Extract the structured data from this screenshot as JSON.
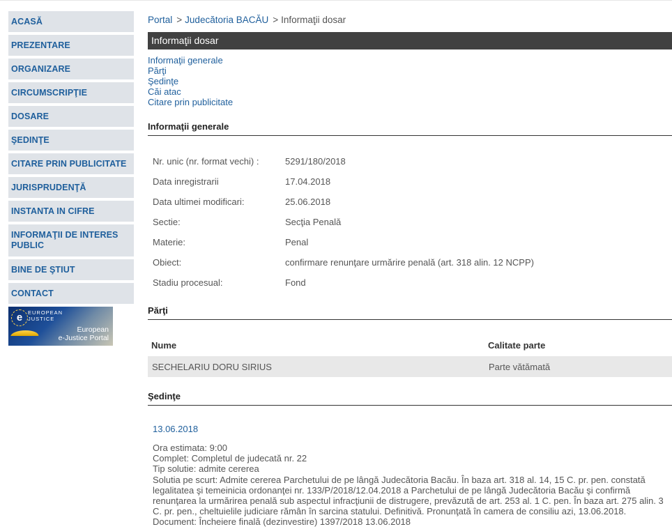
{
  "sidebar": {
    "items": [
      {
        "label": "ACASĂ"
      },
      {
        "label": "PREZENTARE"
      },
      {
        "label": "ORGANIZARE"
      },
      {
        "label": "CIRCUMSCRIPŢIE"
      },
      {
        "label": "DOSARE"
      },
      {
        "label": "ŞEDINŢE"
      },
      {
        "label": "CITARE PRIN PUBLICITATE"
      },
      {
        "label": "JURISPRUDENŢĂ"
      },
      {
        "label": "INSTANTA IN CIFRE"
      },
      {
        "label": "INFORMAŢII DE INTERES PUBLIC"
      },
      {
        "label": "BINE DE ŞTIUT"
      },
      {
        "label": "CONTACT"
      }
    ],
    "ejustice": {
      "logo_letter": "e",
      "line1": "EUROPEAN",
      "line2": "JUSTICE",
      "title1": "European",
      "title2": "e-Justice Portal"
    }
  },
  "breadcrumb": {
    "home": "Portal",
    "sep1": ">",
    "court": "Judecătoria BACĂU",
    "sep2": ">",
    "current": "Informaţii dosar"
  },
  "page_title": "Informaţii dosar",
  "anchors": [
    "Informaţii generale",
    "Părţi",
    "Şedinţe",
    "Căi atac",
    "Citare prin publicitate"
  ],
  "general": {
    "heading": "Informaţii generale",
    "rows": [
      {
        "key": "Nr. unic (nr. format vechi) :",
        "value": "5291/180/2018"
      },
      {
        "key": "Data inregistrarii",
        "value": "17.04.2018"
      },
      {
        "key": "Data ultimei modificari:",
        "value": "25.06.2018"
      },
      {
        "key": "Sectie:",
        "value": "Secţia Penală"
      },
      {
        "key": "Materie:",
        "value": "Penal"
      },
      {
        "key": "Obiect:",
        "value": "confirmare renunţare urmărire penală (art. 318 alin. 12 NCPP)"
      },
      {
        "key": "Stadiu procesual:",
        "value": "Fond"
      }
    ]
  },
  "parti": {
    "heading": "Părţi",
    "col_name": "Nume",
    "col_role": "Calitate parte",
    "rows": [
      {
        "name": "SECHELARIU DORU SIRIUS",
        "role": "Parte vătămată"
      }
    ]
  },
  "sedinte": {
    "heading": "Şedinţe",
    "date": "13.06.2018",
    "ora": "Ora estimata: 9:00",
    "complet": "Complet: Completul de judecată nr. 22",
    "tip": "Tip solutie: admite cererea",
    "solutie": "Solutia pe scurt: Admite cererea Parchetului de pe lângă Judecătoria Bacău. În baza art. 318 al. 14, 15 C. pr. pen. constată legalitatea şi temeinicia ordonanţei nr. 133/P/2018/12.04.2018 a Parchetului de pe lângă Judecătoria Bacău şi confirmă renunţarea la urmărirea penală sub aspectul infracţiunii de distrugere, prevăzută de art. 253 al. 1 C. pen. În baza art. 275 alin. 3 C. pr. pen., cheltuielile judiciare rămân în sarcina statului. Definitivă. Pronunţată în camera de consiliu azi, 13.06.2018.",
    "document": "Document: Încheiere finală (dezinvestire)  1397/2018  13.06.2018"
  }
}
